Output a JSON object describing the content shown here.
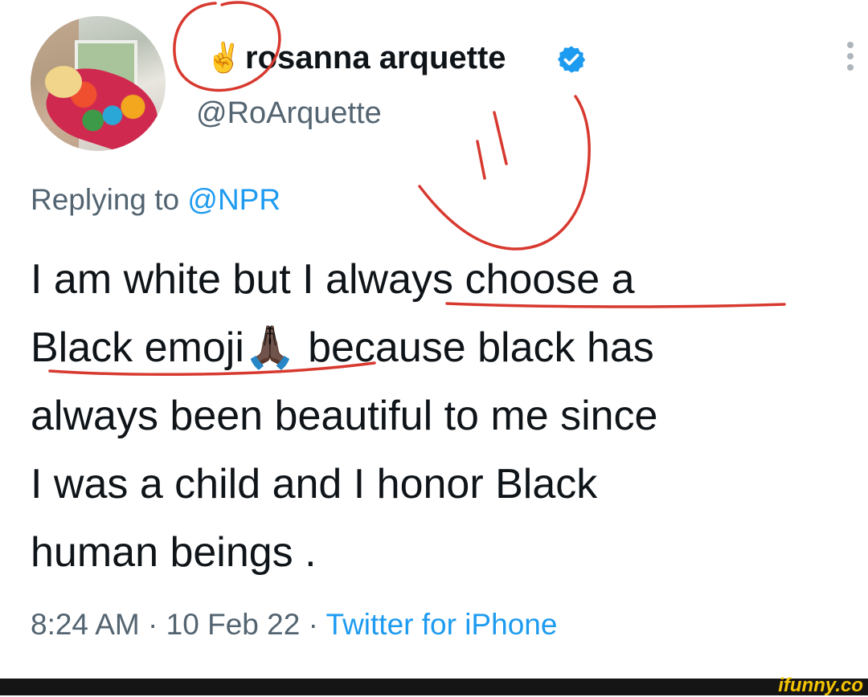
{
  "tweet": {
    "display_name_emoji": "✌️",
    "display_name": "rosanna arquette",
    "handle": "@RoArquette",
    "replying_prefix": "Replying to",
    "replying_to": "@NPR",
    "text_line_1": "I am white but I always choose a",
    "text_line_2_a": "Black emoji",
    "text_line_2_emoji": "🙏🏿",
    "text_line_2_b": " because black has",
    "text_line_3": "always been beautiful to me since",
    "text_line_4": "I was a child and I honor Black",
    "text_line_5": "human beings .",
    "time": "8:24 AM",
    "date": "10 Feb 22",
    "separator": " · ",
    "source": "Twitter for iPhone"
  },
  "watermark": "ifunny.co",
  "colors": {
    "accent": "#1d9bf0",
    "secondary_text": "#536471",
    "annotation": "#d7392f"
  }
}
